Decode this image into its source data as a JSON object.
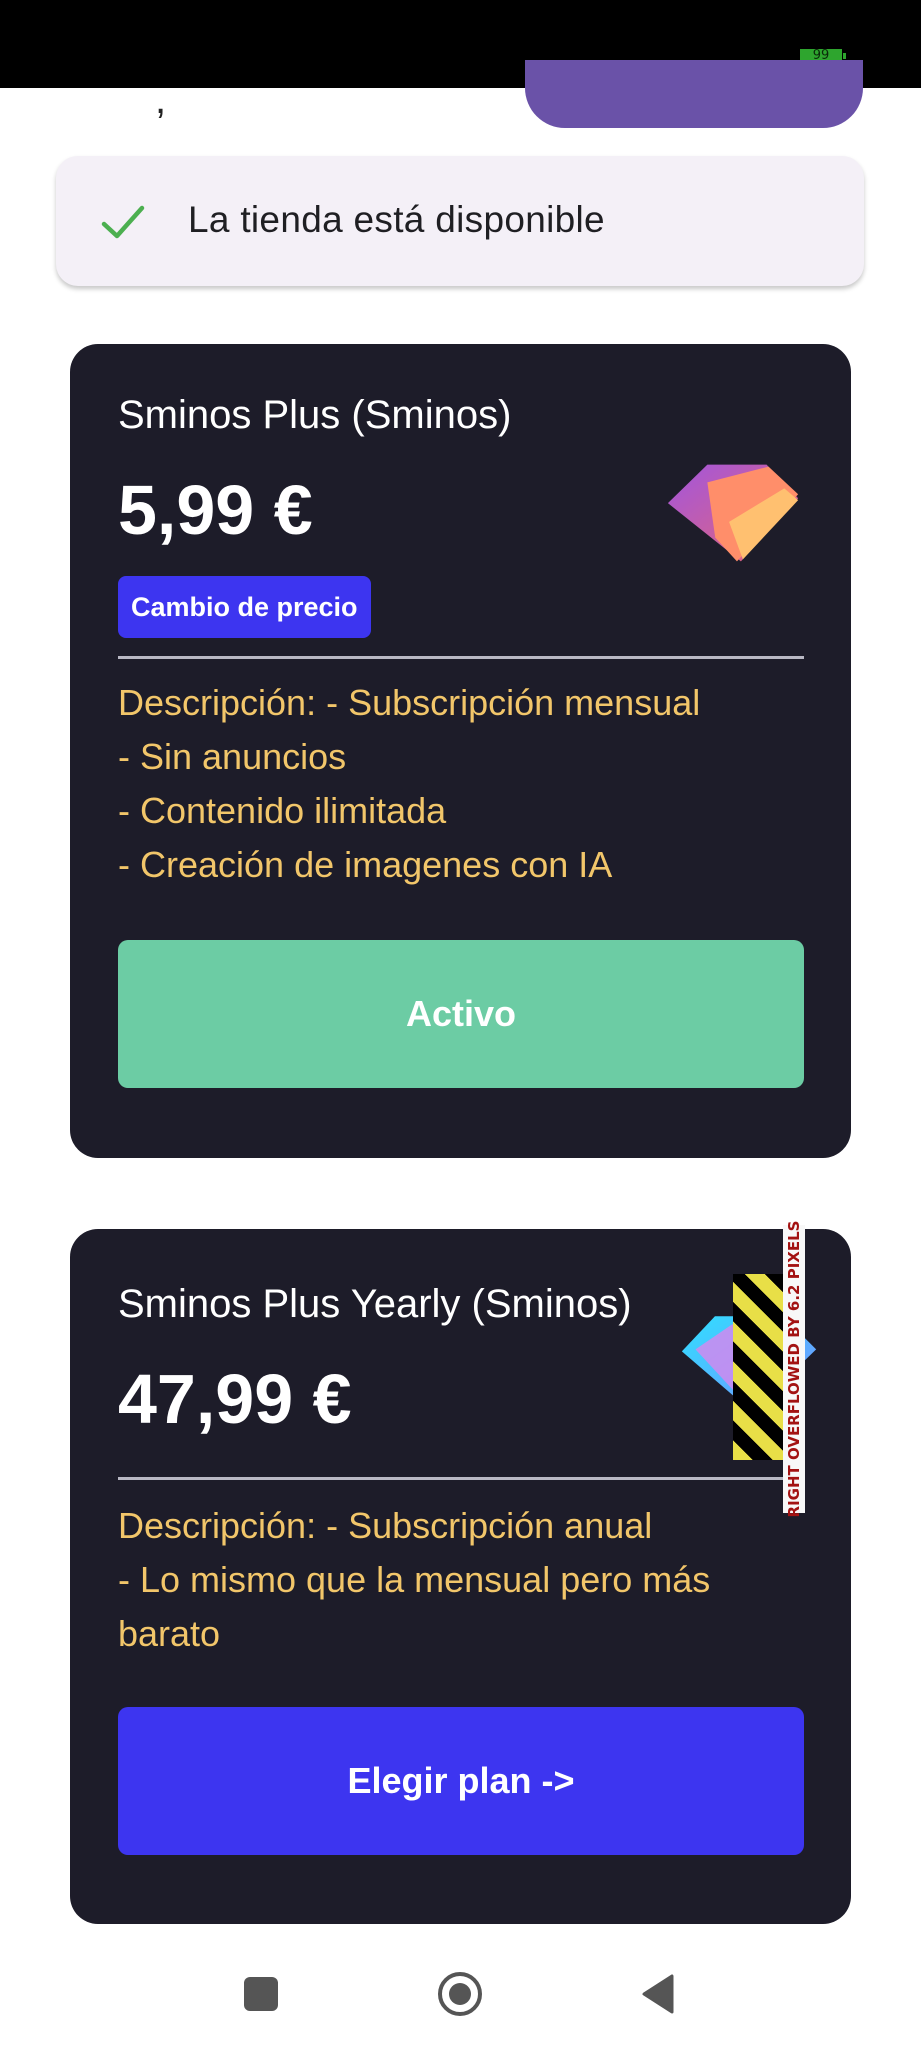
{
  "status_bar": {
    "battery": "99"
  },
  "header": {
    "partial_text": ","
  },
  "store_status": {
    "text": "La tienda está disponible",
    "icon": "check-icon"
  },
  "plans": [
    {
      "title": "Sminos Plus (Sminos)",
      "price": "5,99 €",
      "badge": "Cambio de precio",
      "description": [
        "Descripción: - Subscripción mensual",
        "- Sin anuncios",
        "- Contenido ilimitada",
        "- Creación de imagenes con IA"
      ],
      "button_label": "Activo",
      "button_color": "#6ccca4",
      "icon": "gem-icon"
    },
    {
      "title": "Sminos Plus Yearly (Sminos)",
      "price": "47,99 €",
      "description": [
        "Descripción: - Subscripción anual",
        "- Lo mismo que la mensual pero más",
        "barato"
      ],
      "button_label": "Elegir plan ->",
      "button_color": "#3d35f0",
      "icon": "gem-icon"
    }
  ],
  "overflow_warning": "RIGHT OVERFLOWED BY 6.2 PIXELS",
  "nav": {
    "recents": "square-icon",
    "home": "circle-icon",
    "back": "back-triangle-icon"
  },
  "colors": {
    "card_bg": "#1d1c29",
    "accent": "#3d35f0",
    "description": "#f2c66a",
    "active": "#6ccca4"
  }
}
